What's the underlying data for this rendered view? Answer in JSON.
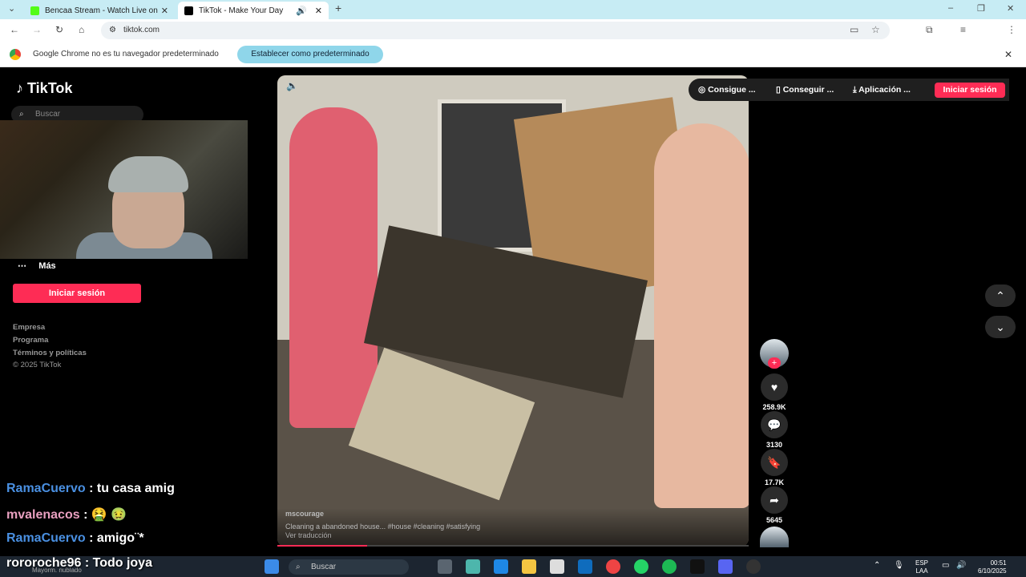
{
  "browser": {
    "tabs": [
      {
        "title": "Bencaa Stream - Watch Live on",
        "favicon_color": "#53fc18"
      },
      {
        "title": "TikTok - Make Your Day",
        "favicon_color": "#000000"
      }
    ],
    "url": "tiktok.com",
    "infobar": {
      "message": "Google Chrome no es tu navegador predeterminado",
      "button": "Establecer como predeterminado"
    }
  },
  "sidebar": {
    "logo": "TikTok",
    "search_placeholder": "Buscar",
    "more_label": "Más",
    "login_label": "Iniciar sesión",
    "footer": [
      "Empresa",
      "Programa",
      "Términos y políticas",
      "© 2025 TikTok"
    ]
  },
  "video": {
    "author": "mscourage",
    "description": "Cleaning a abandoned house... #house #cleaning #satisfying",
    "translate": "Ver traducción",
    "progress": 0.19
  },
  "topbar": {
    "get_coins": "Consigue ...",
    "get_app": "Conseguir ...",
    "application": "Aplicación ...",
    "login": "Iniciar sesión"
  },
  "actions": {
    "likes": "258.9K",
    "comments": "3130",
    "saves": "17.7K",
    "shares": "5645"
  },
  "chat": [
    {
      "user": "RamaCuervo",
      "message": ": tu casa amig",
      "user_color": "#4a90e2"
    },
    {
      "user": "mvalenacos",
      "message": ": 🤮 🤢",
      "user_color": "#e9a0c0"
    },
    {
      "user": "RamaCuervo",
      "message": ": amigo¨*",
      "user_color": "#4a90e2"
    },
    {
      "user": "rororoche96",
      "message": ": Todo joya",
      "user_color": "#ffffff"
    }
  ],
  "taskbar": {
    "weather": "Mayorm. nublado",
    "search_placeholder": "Buscar",
    "lang_top": "ESP",
    "lang_bottom": "LAA",
    "time": "00:51",
    "date": "6/10/2025"
  },
  "colors": {
    "accent": "#fe2c55",
    "chrome_tabbar": "#c7ecf4"
  }
}
